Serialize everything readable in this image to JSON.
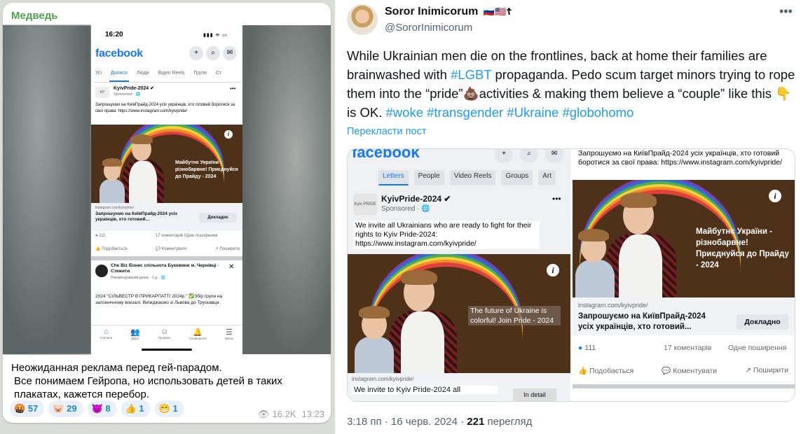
{
  "telegram": {
    "author": "Медведь",
    "message_lines": [
      "Неожиданная реклама перед гей-парадом.",
      "Все понимаем Гейропа, но использовать детей в таких плакатах, кажется перебор."
    ],
    "reactions": [
      {
        "emoji": "🤬",
        "count": "57"
      },
      {
        "emoji": "🐷",
        "count": "29"
      },
      {
        "emoji": "😈",
        "count": "8"
      },
      {
        "emoji": "👍",
        "count": "1"
      },
      {
        "emoji": "😁",
        "count": "1"
      }
    ],
    "views": "16.2K",
    "time": "13:23",
    "phone": {
      "time": "16:20",
      "status": "▮▮▮ ≋ ▭",
      "logo": "facebook",
      "tabs": [
        "Усі",
        "Дописи",
        "Люди",
        "Відео Reels",
        "Групи",
        "Ст"
      ],
      "page_name": "KyivPride-2024 ✔",
      "sponsored": "Sponsored · 🌐",
      "post_text": "Запрошуємо на КиївПрайд-2024 усіх українців, хто готовий боротися за свої права: https://www.instagram.com/kyivpride/",
      "image_text": "Майбутнє України - різнобарвне! Приєднуйся до Прайду - 2024",
      "link_domain": "instagram.com/kyivpride/",
      "link_title": "Запрошуємо на КиївПрайд-2024 усіх українців, хто готовий...",
      "link_button": "Докладно",
      "likes": "111",
      "comments": "17 коментарів  Одне поширення",
      "actions": [
        "👍 Подобається",
        "💬 Коментувати",
        "↗ Поширити"
      ],
      "post2_name": "Che Biz бізнес спільнота Буковини м. Чернівці · Стежити",
      "post2_sub": "Рекомендований допис · 1 д. · 🌐",
      "post2_text": "2024 \"СІЛЬВЕСТР В ПРИКАРПАТТІ 2024р.\" ✅Збір групи на залізничному вокзалі. Виїжджаємо зі Львова до Трускавця.",
      "nav": [
        {
          "icon": "⌂",
          "label": "Головна"
        },
        {
          "icon": "👥",
          "label": "Друзі"
        },
        {
          "icon": "☺",
          "label": "Профіль"
        },
        {
          "icon": "🔔",
          "label": "Сповіщення"
        },
        {
          "icon": "☰",
          "label": "Меню"
        }
      ]
    }
  },
  "tweet": {
    "display_name": "Soror Inimicorum",
    "flags": "🇷🇺🇺🇸☦",
    "handle": "@SororInimicorum",
    "text_parts": [
      "While Ukrainian men die on the frontlines, back at home their families are brainwashed with ",
      "#LGBT",
      " propaganda. Pedo scum target minors trying to rope them into the “pride”💩activities & making them believe a “couple” like this 👇 is OK. ",
      "#woke #transgender #Ukraine  #globohomo"
    ],
    "translate": "Перекласти пост",
    "meta_time": "3:18 пп · 16 черв. 2024 · ",
    "meta_views": "221",
    "meta_views_label": " перегляд",
    "left_shot": {
      "logo": "facebook",
      "tabs": [
        "Letters",
        "People",
        "Video Reels",
        "Groups",
        "Art"
      ],
      "page_name": "KyivPride-2024 ✔",
      "sponsored": "Sponsored · 🌐",
      "post_text": "We invite all Ukrainians who are ready to fight for their rights to Kyiv Pride-2024: https://www.instagram.com/kyivpride/",
      "image_text": "The future of Ukraine is colorful! Join Pride - 2024",
      "link_domain": "instagram.com/kyivpride/",
      "link_title": "We invite to Kyiv Pride-2024 all",
      "button": "In detail"
    },
    "right_shot": {
      "post_text": "Запрошуємо на КиївПрайд-2024 усіх українців, хто готовий боротися за свої права: https://www.instagram.com/kyivpride/",
      "image_text": "Майбутнє України - різнобарвне! Приєднуйся до Прайду - 2024",
      "link_domain": "instagram.com/kyivpride/",
      "link_title": "Запрошуємо на КиївПрайд-2024 усіх українців, хто готовий...",
      "button": "Докладно",
      "likes": "111",
      "comments": "17 коментарів",
      "shares": "Одне поширення",
      "actions": [
        "👍 Подобається",
        "💬 Коментувати",
        "↗ Поширити"
      ]
    }
  },
  "colors": {
    "twitter_link": "#1d9bf0",
    "facebook_blue": "#1877f2",
    "telegram_name": "#4ba34b"
  }
}
